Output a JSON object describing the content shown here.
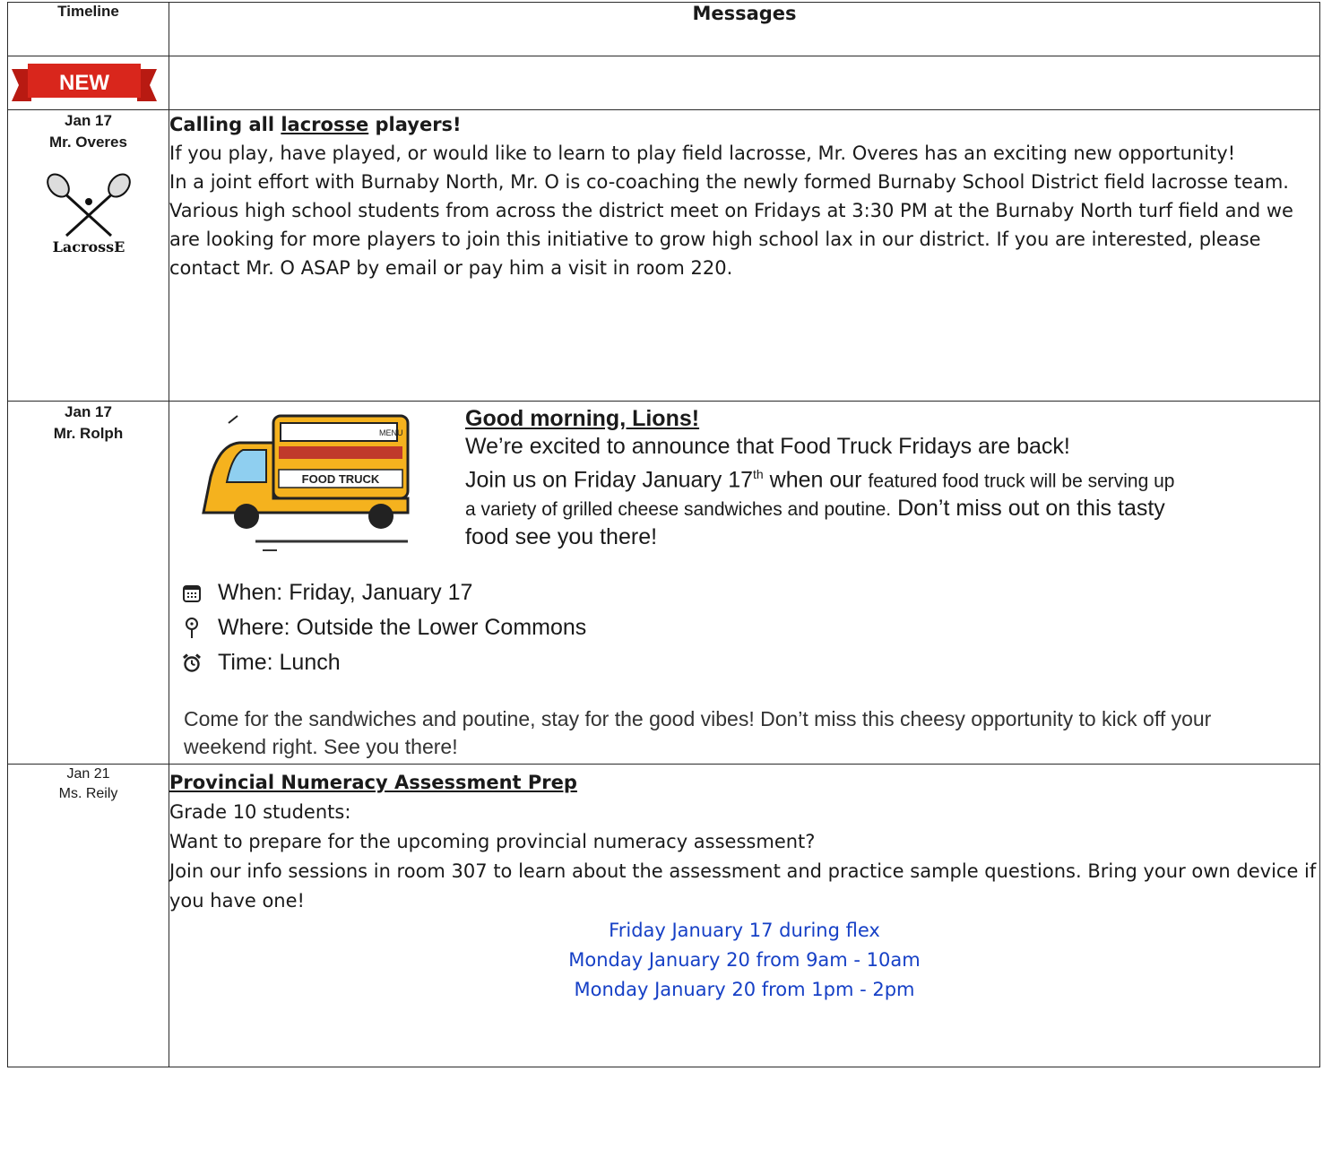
{
  "header": {
    "col_timeline": "Timeline",
    "col_messages": "Messages"
  },
  "new_badge": "NEW",
  "rows": [
    {
      "date": "Jan 17",
      "author": "Mr. Overes",
      "logo_text": "LacrossE",
      "title_prefix": "Calling all ",
      "title_link": "lacrosse",
      "title_suffix": " players!",
      "paragraphs": [
        "If you play, have played, or would like to learn to play field lacrosse, Mr. Overes has an exciting new opportunity!",
        "In a joint effort with Burnaby North, Mr. O is co-coaching the newly formed Burnaby School District field lacrosse team. Various high school students from across the district meet on Fridays at 3:30 PM at the Burnaby North turf field and we are looking for more players to join this initiative to grow high school lax in our district. If you are interested, please contact Mr. O ASAP by email or pay him a visit in room 220."
      ]
    },
    {
      "date": "Jan 17",
      "author": "Mr. Rolph",
      "title": "Good morning, Lions!",
      "intro1": "We’re excited to announce that Food Truck Fridays are back!",
      "intro2_a": "Join us on Friday January 17",
      "intro2_sup": "th",
      "intro2_b": " when our ",
      "intro2_c": "featured food truck will be serving up a variety of grilled cheese sandwiches and poutine.",
      "intro2_d": "  Don’t miss out on this tasty food see you there!",
      "truck_menu": "MENU",
      "truck_label": "FOOD TRUCK",
      "details": [
        {
          "icon": "calendar-icon",
          "text": "When: Friday, January 17"
        },
        {
          "icon": "pin-icon",
          "text": "Where: Outside the Lower Commons"
        },
        {
          "icon": "alarm-clock-icon",
          "text": "Time: Lunch"
        }
      ],
      "closing": "Come for the sandwiches and poutine, stay for the good vibes! Don’t miss this cheesy opportunity to kick off your weekend right. See you there!"
    },
    {
      "date": "Jan 21",
      "author": "Ms. Reily",
      "title": "Provincial Numeracy Assessment Prep",
      "lines": [
        "Grade 10 students:",
        "Want to prepare for the upcoming provincial numeracy assessment?",
        "Join our info sessions in room 307 to learn about the assessment and practice sample questions. Bring your own device if you have one!"
      ],
      "sessions": [
        "Friday January 17 during flex",
        "Monday January 20 from 9am - 10am",
        "Monday January 20 from 1pm - 2pm"
      ]
    }
  ],
  "colors": {
    "badge_red": "#d9261c",
    "link_blue": "#1640c6",
    "top_red": "#e02020"
  }
}
